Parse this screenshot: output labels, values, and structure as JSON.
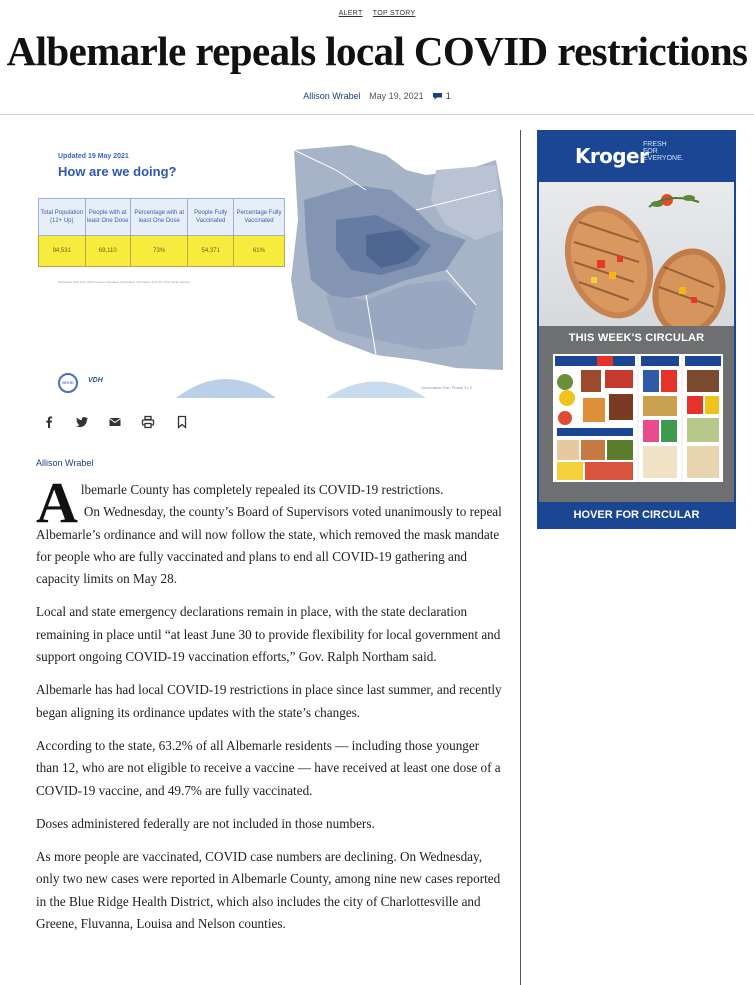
{
  "tags": [
    "ALERT",
    "TOP STORY"
  ],
  "headline": "Albemarle repeals local COVID restrictions",
  "byline": {
    "author": "Allison Wrabel",
    "date": "May 19, 2021",
    "comments": "1"
  },
  "hero": {
    "updated": "Updated 19 May 2021",
    "title": "How are we doing?",
    "table_headers": [
      "Total Population (12+ Up)",
      "People with at least One Dose",
      "Percentage with at least One Dose",
      "People Fully Vaccinated",
      "Percentage Fully Vaccinated"
    ],
    "table_values": [
      "94,531",
      "69,110",
      "73%",
      "54,371",
      "61%"
    ],
    "note": "Population Data from 2019 Census estimates. Vaccination information from the VDH public website.",
    "footer": "Vaccination Plan Phase 3 | 3",
    "logo_left": "BRHD",
    "logo_right": "VDH"
  },
  "share_icons": [
    "facebook-icon",
    "twitter-icon",
    "email-icon",
    "print-icon",
    "bookmark-icon"
  ],
  "article_author": "Allison Wrabel",
  "article": {
    "dropcap": "A",
    "p1": "lbemarle County has completely repealed its COVID-19 restrictions.",
    "p2": "On Wednesday, the county’s Board of Supervisors voted unanimously to repeal Albemarle’s ordinance and will now follow the state, which removed the mask mandate for people who are fully vaccinated and plans to end all COVID-19 gathering and capacity limits on May 28.",
    "p3": "Local and state emergency declarations remain in place, with the state declaration remaining in place until “at least June 30 to provide flexibility for local government and support ongoing COVID-19 vaccination efforts,” Gov. Ralph Northam said.",
    "p4": "Albemarle has had local COVID-19 restrictions in place since last summer, and recently began aligning its ordinance updates with the state’s changes.",
    "p5": "According to the state, 63.2% of all Albemarle residents — including those younger than 12, who are not eligible to receive a vaccine — have received at least one dose of a COVID-19 vaccine, and 49.7% are fully vaccinated.",
    "p6": "Doses administered federally are not included in those numbers.",
    "p7": "As more people are vaccinated, COVID case numbers are declining. On Wednesday, only two new cases were reported in Albemarle County, among nine new cases reported in the Blue Ridge Health District, which also includes the city of Charlottesville and Greene, Fluvanna, Louisa and Nelson counties."
  },
  "ad": {
    "brand": "Kroger",
    "tagline": [
      "FRESH",
      "FOR",
      "EVERYONE."
    ],
    "circular_title": "THIS WEEK'S CIRCULAR",
    "button": "HOVER FOR CIRCULAR",
    "brand_color": "#1b4694"
  }
}
